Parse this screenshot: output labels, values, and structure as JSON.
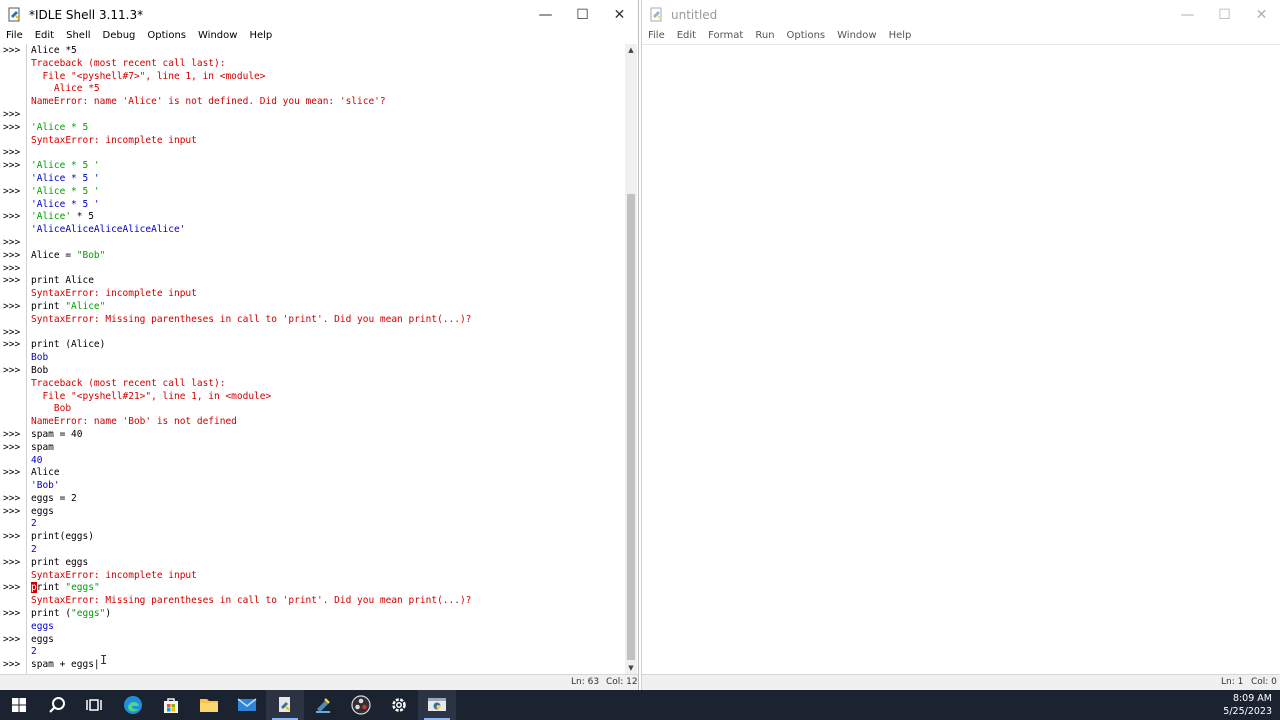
{
  "shell_window": {
    "title": "*IDLE Shell 3.11.3*",
    "menu": [
      "File",
      "Edit",
      "Shell",
      "Debug",
      "Options",
      "Window",
      "Help"
    ],
    "status": {
      "ln": "Ln: 63",
      "col": "Col: 12"
    },
    "lines": [
      {
        "p": ">>>",
        "segs": [
          {
            "t": "Alice *5",
            "c": "c-code"
          }
        ]
      },
      {
        "p": "",
        "segs": [
          {
            "t": "Traceback (most recent call last):",
            "c": "c-err"
          }
        ]
      },
      {
        "p": "",
        "segs": [
          {
            "t": "  File \"<pyshell#7>\", line 1, in <module>",
            "c": "c-err"
          }
        ]
      },
      {
        "p": "",
        "segs": [
          {
            "t": "    Alice *5",
            "c": "c-err"
          }
        ]
      },
      {
        "p": "",
        "segs": [
          {
            "t": "NameError: name 'Alice' is not defined. Did you mean: 'slice'?",
            "c": "c-err"
          }
        ]
      },
      {
        "p": ">>>",
        "segs": []
      },
      {
        "p": ">>>",
        "segs": [
          {
            "t": "'Alice * 5",
            "c": "c-str"
          }
        ]
      },
      {
        "p": "",
        "segs": [
          {
            "t": "SyntaxError: incomplete input",
            "c": "c-err"
          }
        ]
      },
      {
        "p": ">>>",
        "segs": []
      },
      {
        "p": ">>>",
        "segs": [
          {
            "t": "'Alice * 5 '",
            "c": "c-str"
          }
        ]
      },
      {
        "p": "",
        "segs": [
          {
            "t": "'Alice * 5 '",
            "c": "c-out"
          }
        ]
      },
      {
        "p": ">>>",
        "segs": [
          {
            "t": "'Alice * 5 '",
            "c": "c-str"
          }
        ]
      },
      {
        "p": "",
        "segs": [
          {
            "t": "'Alice * 5 '",
            "c": "c-out"
          }
        ]
      },
      {
        "p": ">>>",
        "segs": [
          {
            "t": "'Alice'",
            "c": "c-str"
          },
          {
            "t": " * 5",
            "c": "c-code"
          }
        ]
      },
      {
        "p": "",
        "segs": [
          {
            "t": "'AliceAliceAliceAliceAlice'",
            "c": "c-out"
          }
        ]
      },
      {
        "p": ">>>",
        "segs": []
      },
      {
        "p": ">>>",
        "segs": [
          {
            "t": "Alice = ",
            "c": "c-code"
          },
          {
            "t": "\"Bob\"",
            "c": "c-str"
          }
        ]
      },
      {
        "p": ">>>",
        "segs": []
      },
      {
        "p": ">>>",
        "segs": [
          {
            "t": "print Alice",
            "c": "c-code"
          }
        ]
      },
      {
        "p": "",
        "segs": [
          {
            "t": "SyntaxError: incomplete input",
            "c": "c-err"
          }
        ]
      },
      {
        "p": ">>>",
        "segs": [
          {
            "t": "print ",
            "c": "c-code"
          },
          {
            "t": "\"Alice\"",
            "c": "c-str"
          }
        ]
      },
      {
        "p": "",
        "segs": [
          {
            "t": "SyntaxError: Missing parentheses in call to 'print'. Did you mean print(...)?",
            "c": "c-err"
          }
        ]
      },
      {
        "p": ">>>",
        "segs": []
      },
      {
        "p": ">>>",
        "segs": [
          {
            "t": "print (Alice)",
            "c": "c-code"
          }
        ]
      },
      {
        "p": "",
        "segs": [
          {
            "t": "Bob",
            "c": "c-out"
          }
        ]
      },
      {
        "p": ">>>",
        "segs": [
          {
            "t": "Bob",
            "c": "c-code"
          }
        ]
      },
      {
        "p": "",
        "segs": [
          {
            "t": "Traceback (most recent call last):",
            "c": "c-err"
          }
        ]
      },
      {
        "p": "",
        "segs": [
          {
            "t": "  File \"<pyshell#21>\", line 1, in <module>",
            "c": "c-err"
          }
        ]
      },
      {
        "p": "",
        "segs": [
          {
            "t": "    Bob",
            "c": "c-err"
          }
        ]
      },
      {
        "p": "",
        "segs": [
          {
            "t": "NameError: name 'Bob' is not defined",
            "c": "c-err"
          }
        ]
      },
      {
        "p": ">>>",
        "segs": [
          {
            "t": "spam = 40",
            "c": "c-code"
          }
        ]
      },
      {
        "p": ">>>",
        "segs": [
          {
            "t": "spam",
            "c": "c-code"
          }
        ]
      },
      {
        "p": "",
        "segs": [
          {
            "t": "40",
            "c": "c-out"
          }
        ]
      },
      {
        "p": ">>>",
        "segs": [
          {
            "t": "Alice",
            "c": "c-code"
          }
        ]
      },
      {
        "p": "",
        "segs": [
          {
            "t": "'Bob'",
            "c": "c-out"
          }
        ]
      },
      {
        "p": ">>>",
        "segs": [
          {
            "t": "eggs = 2",
            "c": "c-code"
          }
        ]
      },
      {
        "p": ">>>",
        "segs": [
          {
            "t": "eggs",
            "c": "c-code"
          }
        ]
      },
      {
        "p": "",
        "segs": [
          {
            "t": "2",
            "c": "c-out"
          }
        ]
      },
      {
        "p": ">>>",
        "segs": [
          {
            "t": "print(eggs)",
            "c": "c-code"
          }
        ]
      },
      {
        "p": "",
        "segs": [
          {
            "t": "2",
            "c": "c-out"
          }
        ]
      },
      {
        "p": ">>>",
        "segs": [
          {
            "t": "print eggs",
            "c": "c-code"
          }
        ]
      },
      {
        "p": "",
        "segs": [
          {
            "t": "SyntaxError: incomplete input",
            "c": "c-err"
          }
        ]
      },
      {
        "p": ">>>",
        "segs": [
          {
            "t": "p",
            "c": "cursor-mark"
          },
          {
            "t": "rint ",
            "c": "c-code"
          },
          {
            "t": "\"eggs\"",
            "c": "c-str"
          }
        ]
      },
      {
        "p": "",
        "segs": [
          {
            "t": "SyntaxError: Missing parentheses in call to 'print'. Did you mean print(...)?",
            "c": "c-err"
          }
        ]
      },
      {
        "p": ">>>",
        "segs": [
          {
            "t": "print (",
            "c": "c-code"
          },
          {
            "t": "\"eggs\"",
            "c": "c-str"
          },
          {
            "t": ")",
            "c": "c-code"
          }
        ]
      },
      {
        "p": "",
        "segs": [
          {
            "t": "eggs",
            "c": "c-out"
          }
        ]
      },
      {
        "p": ">>>",
        "segs": [
          {
            "t": "eggs",
            "c": "c-code"
          }
        ]
      },
      {
        "p": "",
        "segs": [
          {
            "t": "2",
            "c": "c-out"
          }
        ]
      },
      {
        "p": ">>>",
        "segs": [
          {
            "t": "spam + eggs",
            "c": "c-code"
          },
          {
            "t": "|",
            "c": "c-code"
          }
        ]
      }
    ]
  },
  "editor_window": {
    "title": "untitled",
    "menu": [
      "File",
      "Edit",
      "Format",
      "Run",
      "Options",
      "Window",
      "Help"
    ],
    "status": {
      "ln": "Ln: 1",
      "col": "Col: 0"
    }
  },
  "taskbar": {
    "icons": [
      "windows-start-icon",
      "search-icon",
      "task-view-icon",
      "edge-browser-icon",
      "microsoft-store-icon",
      "file-explorer-icon",
      "mail-icon",
      "idle-file-icon",
      "python-icon",
      "obs-icon",
      "settings-gear-icon",
      "python-launcher-icon"
    ],
    "time": "8:09 AM",
    "date": "5/25/2023"
  },
  "colors": {
    "error": "#d20000",
    "output": "#0000c8",
    "string": "#00a000",
    "taskbar": "#1b2230"
  }
}
